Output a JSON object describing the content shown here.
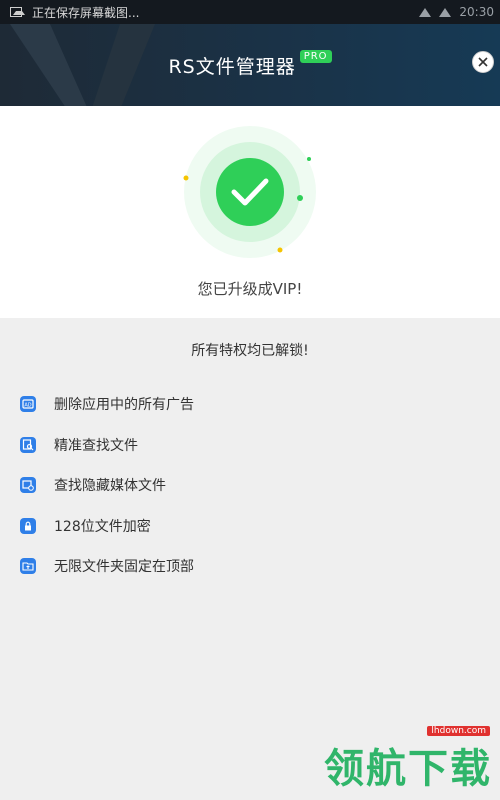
{
  "status_bar": {
    "notification": "正在保存屏幕截图...",
    "time": "20:30"
  },
  "header": {
    "title": "RS文件管理器",
    "badge": "PRO"
  },
  "hero": {
    "message": "您已升级成VIP!"
  },
  "unlock": {
    "title": "所有特权均已解锁!",
    "features": [
      {
        "label": "删除应用中的所有广告",
        "icon": "ad-remove-icon"
      },
      {
        "label": "精准查找文件",
        "icon": "file-search-icon"
      },
      {
        "label": "查找隐藏媒体文件",
        "icon": "hidden-media-icon"
      },
      {
        "label": "128位文件加密",
        "icon": "lock-icon"
      },
      {
        "label": "无限文件夹固定在顶部",
        "icon": "folder-pin-icon"
      }
    ]
  },
  "watermark": {
    "text": "领航下载",
    "url": "lhdown.com"
  },
  "colors": {
    "accent_green": "#2fcf58",
    "icon_blue": "#2f7fe8",
    "header_dark": "#1a3247"
  }
}
